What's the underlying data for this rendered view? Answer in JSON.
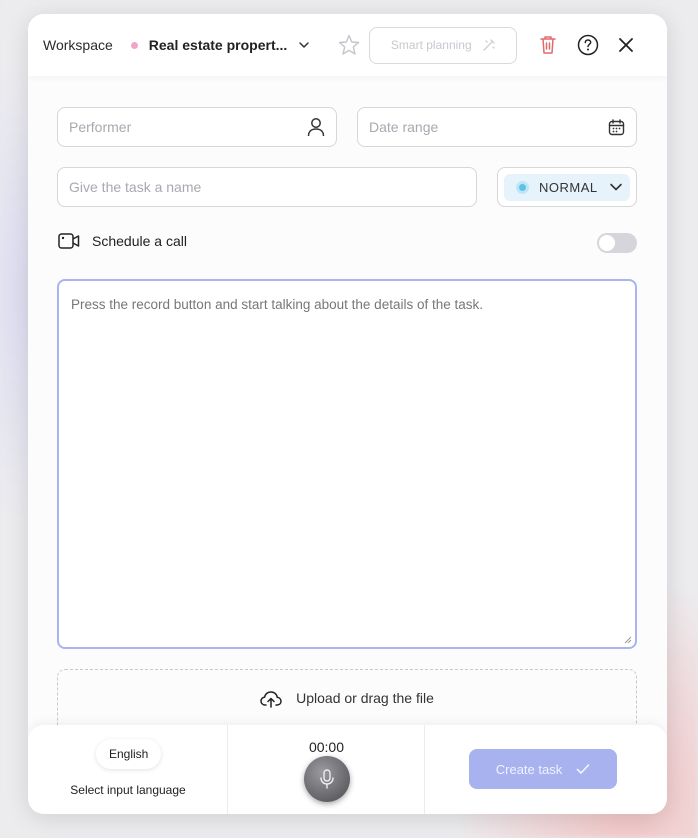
{
  "header": {
    "workspace_label": "Workspace",
    "workspace_name": "Real estate propert...",
    "smart_planning_label": "Smart planning"
  },
  "form": {
    "performer_placeholder": "Performer",
    "date_range_placeholder": "Date range",
    "task_name_placeholder": "Give the task a name",
    "priority_value": "NORMAL",
    "schedule_call_label": "Schedule a call",
    "schedule_call_enabled": false,
    "description_placeholder": "Press the record button and start talking about the details of the task.",
    "upload_label": "Upload or drag the file"
  },
  "footer": {
    "language": "English",
    "language_caption": "Select input language",
    "timer": "00:00",
    "create_task_label": "Create task"
  },
  "colors": {
    "accent": "#a7b2ef",
    "workspace_dot": "#f1a4c8",
    "priority_dot": "#5ec1e8",
    "trash_red": "#e06b6b"
  },
  "icons": {
    "performer": "person-icon",
    "date": "calendar-icon",
    "schedule": "video-camera-icon",
    "upload": "cloud-upload-icon",
    "record": "microphone-icon",
    "create": "check-icon"
  }
}
